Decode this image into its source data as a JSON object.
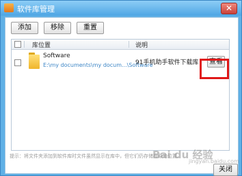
{
  "window": {
    "title": "软件库管理",
    "close_glyph": "✕"
  },
  "toolbar": {
    "add_label": "添加",
    "remove_label": "移除",
    "reset_label": "重置"
  },
  "list": {
    "columns": [
      "库位置",
      "说明"
    ],
    "rows": [
      {
        "name": "Software",
        "path": "E:\\my documents\\my docum...\\Software",
        "description": "91手机助手软件下载库",
        "action_label": "查看"
      }
    ]
  },
  "footer": {
    "hint": "提示：将文件夹添加到软件库时文件虽然显示在库中，但它们仍存储在原始位置。",
    "close_label": "关闭"
  },
  "watermark": {
    "text": "Bai du 经验",
    "sub": "jingyan.baidu.com"
  },
  "colors": {
    "highlight": "#e01818",
    "path_link": "#3d86c6",
    "title_bar": "#5fb0e6"
  }
}
